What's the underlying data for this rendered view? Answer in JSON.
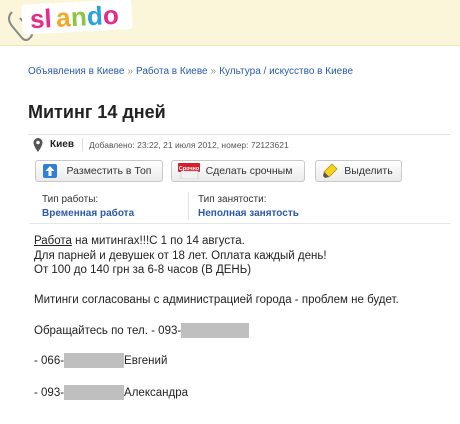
{
  "header": {
    "logo_text": "slando"
  },
  "breadcrumb": [
    "Объявления в Киеве",
    "Работа в Киеве",
    "Культура / искусство в Киеве"
  ],
  "breadcrumb_separator": "»",
  "title": "Митинг 14 дней",
  "meta": {
    "city": "Киев",
    "added": "Добавлено: 23:22, 21 июля 2012, номер: 72123621"
  },
  "actions": {
    "top": "Разместить в Топ",
    "urgent": "Сделать срочным",
    "urgent_badge": "Срочно",
    "highlight": "Выделить"
  },
  "details": {
    "job_type_label": "Тип работы:",
    "job_type_value": "Временная работа",
    "employment_label": "Тип занятости:",
    "employment_value": "Неполная занятость"
  },
  "description": {
    "l1_underlined": "Работа",
    "l1_rest": " на митингах!!!С 1 по 14 августа.",
    "l2": "Для парней и девушек от 18 лет. Оплата каждый день!",
    "l3": "От 100 до 140 грн за 6-8 часов (В ДЕНЬ)",
    "l4": "Митинги согласованы с администрацией города - проблем не будет."
  },
  "contacts": {
    "intro": "Обращайтесь по тел. - 093-",
    "c1_prefix": "- 066-",
    "c1_name": " Евгений",
    "c2_prefix": "- 093-",
    "c2_name": " Александра"
  },
  "colors": {
    "link": "#2a5aa8",
    "header_bg": "#fbf6d9",
    "logo_pink": "#e8298a",
    "logo_green": "#8bc53f"
  }
}
